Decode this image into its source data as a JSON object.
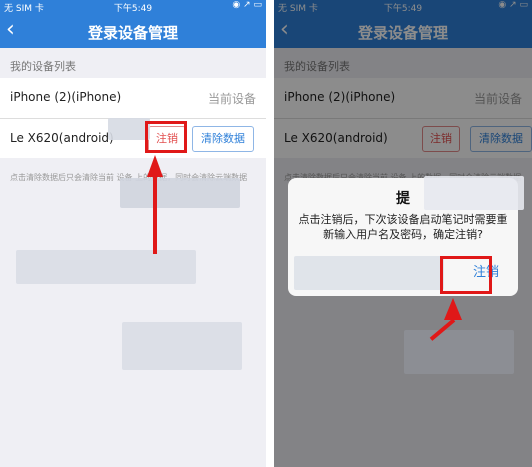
{
  "status_bar": {
    "carrier": "无 SIM 卡 ",
    "time": "下午5:49",
    "indicators": "◉ ↗ ▭"
  },
  "nav": {
    "back_icon": "chevron-left-icon",
    "title": "登录设备管理"
  },
  "section_title": "我的设备列表",
  "devices": [
    {
      "name": "iPhone (2)(iPhone)",
      "status": "当前设备"
    },
    {
      "name": "Le X620(android)",
      "logout_label": "注销",
      "clear_label": "清除数据"
    }
  ],
  "note": "点击清除数据后只会清除当前 设备 上的数据，同时会清除云端数据",
  "dialog": {
    "title": "提",
    "message": "点击注销后，下次该设备启动笔记时需要重新输入用户名及密码，确定注销?",
    "confirm_label": "注销"
  },
  "colors": {
    "primary": "#2f80d9",
    "danger": "#e25050",
    "annotation": "#e01818"
  }
}
